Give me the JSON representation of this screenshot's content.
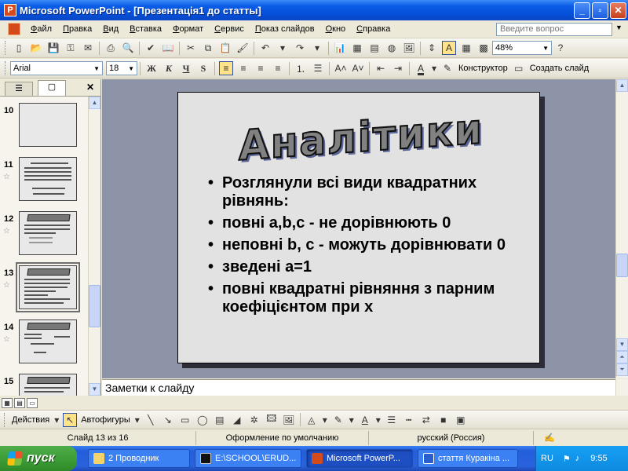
{
  "window": {
    "title": "Microsoft PowerPoint - [Презентація1 до статты]",
    "minimize": "_",
    "restore": "▫",
    "close": "✕"
  },
  "menubar": {
    "items": [
      "Файл",
      "Правка",
      "Вид",
      "Вставка",
      "Формат",
      "Сервис",
      "Показ слайдов",
      "Окно",
      "Справка"
    ],
    "help_placeholder": "Введите вопрос"
  },
  "toolbar_standard": {
    "zoom": "48%"
  },
  "toolbar_formatting": {
    "font": "Arial",
    "font_size": "18",
    "bold": "Ж",
    "italic": "К",
    "underline": "Ч",
    "shadow": "S",
    "designer_label": "Конструктор",
    "new_slide_label": "Создать слайд"
  },
  "left_pane": {
    "tab_outline": "☰",
    "tab_slides": "▢",
    "close": "✕",
    "thumbnails": [
      {
        "num": "10"
      },
      {
        "num": "11"
      },
      {
        "num": "12"
      },
      {
        "num": "13"
      },
      {
        "num": "14"
      },
      {
        "num": "15"
      }
    ]
  },
  "slide": {
    "title": "Аналітики",
    "bullets": [
      "Розглянули всі види квадратних рівнянь:",
      "повні    a,b,c - не дорівнюють 0",
      "неповні  b, c - можуть дорівнювати 0",
      "зведені  a=1",
      "повні квадратні рівняння з парним коефіцієнтом при х"
    ]
  },
  "notes": {
    "placeholder": "Заметки к слайду"
  },
  "drawing_toolbar": {
    "actions_label": "Действия",
    "autoshapes_label": "Автофигуры"
  },
  "statusbar": {
    "slide_count": "Слайд 13 из 16",
    "design": "Оформление по умолчанию",
    "language": "русский (Россия)"
  },
  "taskbar": {
    "start_label": "пуск",
    "tasks": [
      {
        "label": "2 Проводник"
      },
      {
        "label": "E:\\SCHOOL\\ERUD..."
      },
      {
        "label": "Microsoft PowerP..."
      },
      {
        "label": "стаття Куракіна ..."
      }
    ],
    "lang": "RU",
    "clock": "9:55"
  },
  "colors": {
    "title_bar": "#0550d8",
    "slide_area_bg": "#8d94a8",
    "slide_bg": "#e2e2e2",
    "taskbar": "#245edb",
    "start_button": "#3a9a34"
  }
}
